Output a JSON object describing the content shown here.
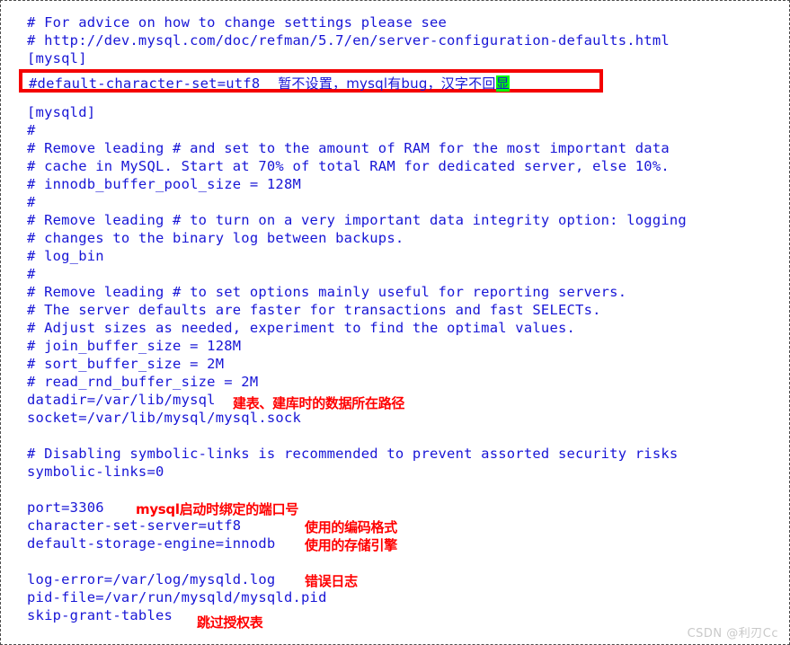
{
  "document": {
    "kind": "mysql-config-file",
    "border_style": "dashed",
    "colors": {
      "code_text": "#1816d6",
      "annotation_red": "#ff0000",
      "highlight_box_border": "#f40000",
      "highlight_green": "#00ff00",
      "background": "#ffffff",
      "watermark": "#c9c9c9"
    }
  },
  "code_lines": [
    {
      "id": "l1",
      "text": "# For advice on how to change settings please see"
    },
    {
      "id": "l2",
      "text": "# http://dev.mysql.com/doc/refman/5.7/en/server-configuration-defaults.html"
    },
    {
      "id": "l3",
      "text": "[mysql]"
    },
    {
      "id": "l4",
      "text": ""
    },
    {
      "id": "l5",
      "text": ""
    },
    {
      "id": "l6",
      "text": "[mysqld]"
    },
    {
      "id": "l7",
      "text": "#"
    },
    {
      "id": "l8",
      "text": "# Remove leading # and set to the amount of RAM for the most important data"
    },
    {
      "id": "l9",
      "text": "# cache in MySQL. Start at 70% of total RAM for dedicated server, else 10%."
    },
    {
      "id": "l10",
      "text": "# innodb_buffer_pool_size = 128M"
    },
    {
      "id": "l11",
      "text": "#"
    },
    {
      "id": "l12",
      "text": "# Remove leading # to turn on a very important data integrity option: logging"
    },
    {
      "id": "l13",
      "text": "# changes to the binary log between backups."
    },
    {
      "id": "l14",
      "text": "# log_bin"
    },
    {
      "id": "l15",
      "text": "#"
    },
    {
      "id": "l16",
      "text": "# Remove leading # to set options mainly useful for reporting servers."
    },
    {
      "id": "l17",
      "text": "# The server defaults are faster for transactions and fast SELECTs."
    },
    {
      "id": "l18",
      "text": "# Adjust sizes as needed, experiment to find the optimal values."
    },
    {
      "id": "l19",
      "text": "# join_buffer_size = 128M"
    },
    {
      "id": "l20",
      "text": "# sort_buffer_size = 2M"
    },
    {
      "id": "l21",
      "text": "# read_rnd_buffer_size = 2M"
    },
    {
      "id": "l22",
      "text": "datadir=/var/lib/mysql"
    },
    {
      "id": "l23",
      "text": "socket=/var/lib/mysql/mysql.sock"
    },
    {
      "id": "l24",
      "text": ""
    },
    {
      "id": "l25",
      "text": "# Disabling symbolic-links is recommended to prevent assorted security risks"
    },
    {
      "id": "l26",
      "text": "symbolic-links=0"
    },
    {
      "id": "l27",
      "text": ""
    },
    {
      "id": "l28",
      "text": "port=3306"
    },
    {
      "id": "l29",
      "text": "character-set-server=utf8"
    },
    {
      "id": "l30",
      "text": "default-storage-engine=innodb"
    },
    {
      "id": "l31",
      "text": ""
    },
    {
      "id": "l32",
      "text": "log-error=/var/log/mysqld.log"
    },
    {
      "id": "l33",
      "text": "pid-file=/var/run/mysqld/mysqld.pid"
    },
    {
      "id": "l34",
      "text": "skip-grant-tables"
    }
  ],
  "boxed_line": {
    "code": "#default-character-set=utf8",
    "note_before_highlight": "    暂不设置，mysql有bug，汉字不回",
    "note_highlighted": "显"
  },
  "annotations": {
    "datadir": "建表、建库时的数据所在路径",
    "port": "mysql启动时绑定的端口号",
    "charset": "使用的编码格式",
    "engine": "使用的存储引擎",
    "log_error": "错误日志",
    "skip_grant_tables": "跳过授权表"
  },
  "watermark": {
    "text": "CSDN @利刃Cc"
  }
}
